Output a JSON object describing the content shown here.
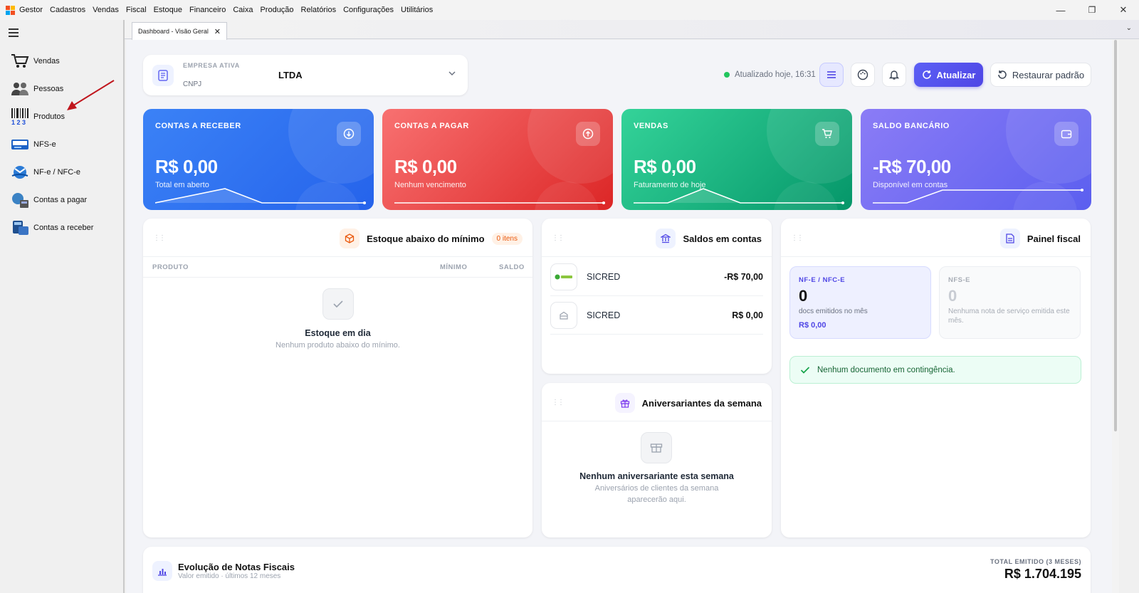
{
  "titlebar": {
    "app": "Gestor",
    "menu": [
      "Cadastros",
      "Vendas",
      "Fiscal",
      "Estoque",
      "Financeiro",
      "Caixa",
      "Produção",
      "Relatórios",
      "Configurações",
      "Utilitários"
    ],
    "minimize": "—",
    "maximize": "❐",
    "close": "✕"
  },
  "sidebar": {
    "items": [
      {
        "label": "Vendas",
        "icon": "cart-icon"
      },
      {
        "label": "Pessoas",
        "icon": "people-icon"
      },
      {
        "label": "Produtos",
        "icon": "barcode-icon"
      },
      {
        "label": "NFS-e",
        "icon": "nfse-icon"
      },
      {
        "label": "NF-e / NFC-e",
        "icon": "nfe-icon"
      },
      {
        "label": "Contas a pagar",
        "icon": "payables-icon"
      },
      {
        "label": "Contas a receber",
        "icon": "receivables-icon"
      }
    ]
  },
  "tabs": {
    "active": "Dashboard - Visão Geral",
    "close": "✕"
  },
  "header": {
    "company_label": "EMPRESA ATIVA",
    "cnpj_label": "CNPJ",
    "company_name": "LTDA",
    "status": "Atualizado hoje, 16:31",
    "refresh": "Atualizar",
    "restore": "Restaurar padrão"
  },
  "kpis": [
    {
      "title": "CONTAS A RECEBER",
      "value": "R$ 0,00",
      "sub": "Total em aberto",
      "color": "#2f6ee8"
    },
    {
      "title": "CONTAS A PAGAR",
      "value": "R$ 0,00",
      "sub": "Nenhum vencimento",
      "color": "#e9434a"
    },
    {
      "title": "VENDAS",
      "value": "R$ 0,00",
      "sub": "Faturamento de hoje",
      "color": "#17ab74"
    },
    {
      "title": "SALDO BANCÁRIO",
      "value": "-R$ 70,00",
      "sub": "Disponível em contas",
      "color": "#6b63ef"
    }
  ],
  "stock": {
    "title": "Estoque abaixo do mínimo",
    "badge": "0 itens",
    "cols": [
      "PRODUTO",
      "MÍNIMO",
      "SALDO"
    ],
    "empty_title": "Estoque em dia",
    "empty_sub": "Nenhum produto abaixo do mínimo."
  },
  "balances": {
    "title": "Saldos em contas",
    "rows": [
      {
        "name": "SICRED",
        "value": "-R$ 70,00"
      },
      {
        "name": "SICRED",
        "value": "R$ 0,00"
      }
    ]
  },
  "birthdays": {
    "title": "Aniversariantes da semana",
    "empty_title": "Nenhum aniversariante esta semana",
    "empty_sub1": "Aniversários de clientes da semana",
    "empty_sub2": "aparecerão aqui."
  },
  "fiscal": {
    "title": "Painel fiscal",
    "nfe": {
      "label": "NF-E / NFC-E",
      "count": "0",
      "sub": "docs emitidos no mês",
      "value": "R$ 0,00"
    },
    "nfse": {
      "label": "NFS-E",
      "count": "0",
      "sub": "Nenhuma nota de serviço emitida este mês."
    },
    "contingency": "Nenhum documento em contingência."
  },
  "evolution": {
    "title": "Evolução de Notas Fiscais",
    "sub": "Valor emitido · últimos 12 meses",
    "total_label": "TOTAL EMITIDO (3 MESES)",
    "total": "R$ 1.704.195"
  }
}
